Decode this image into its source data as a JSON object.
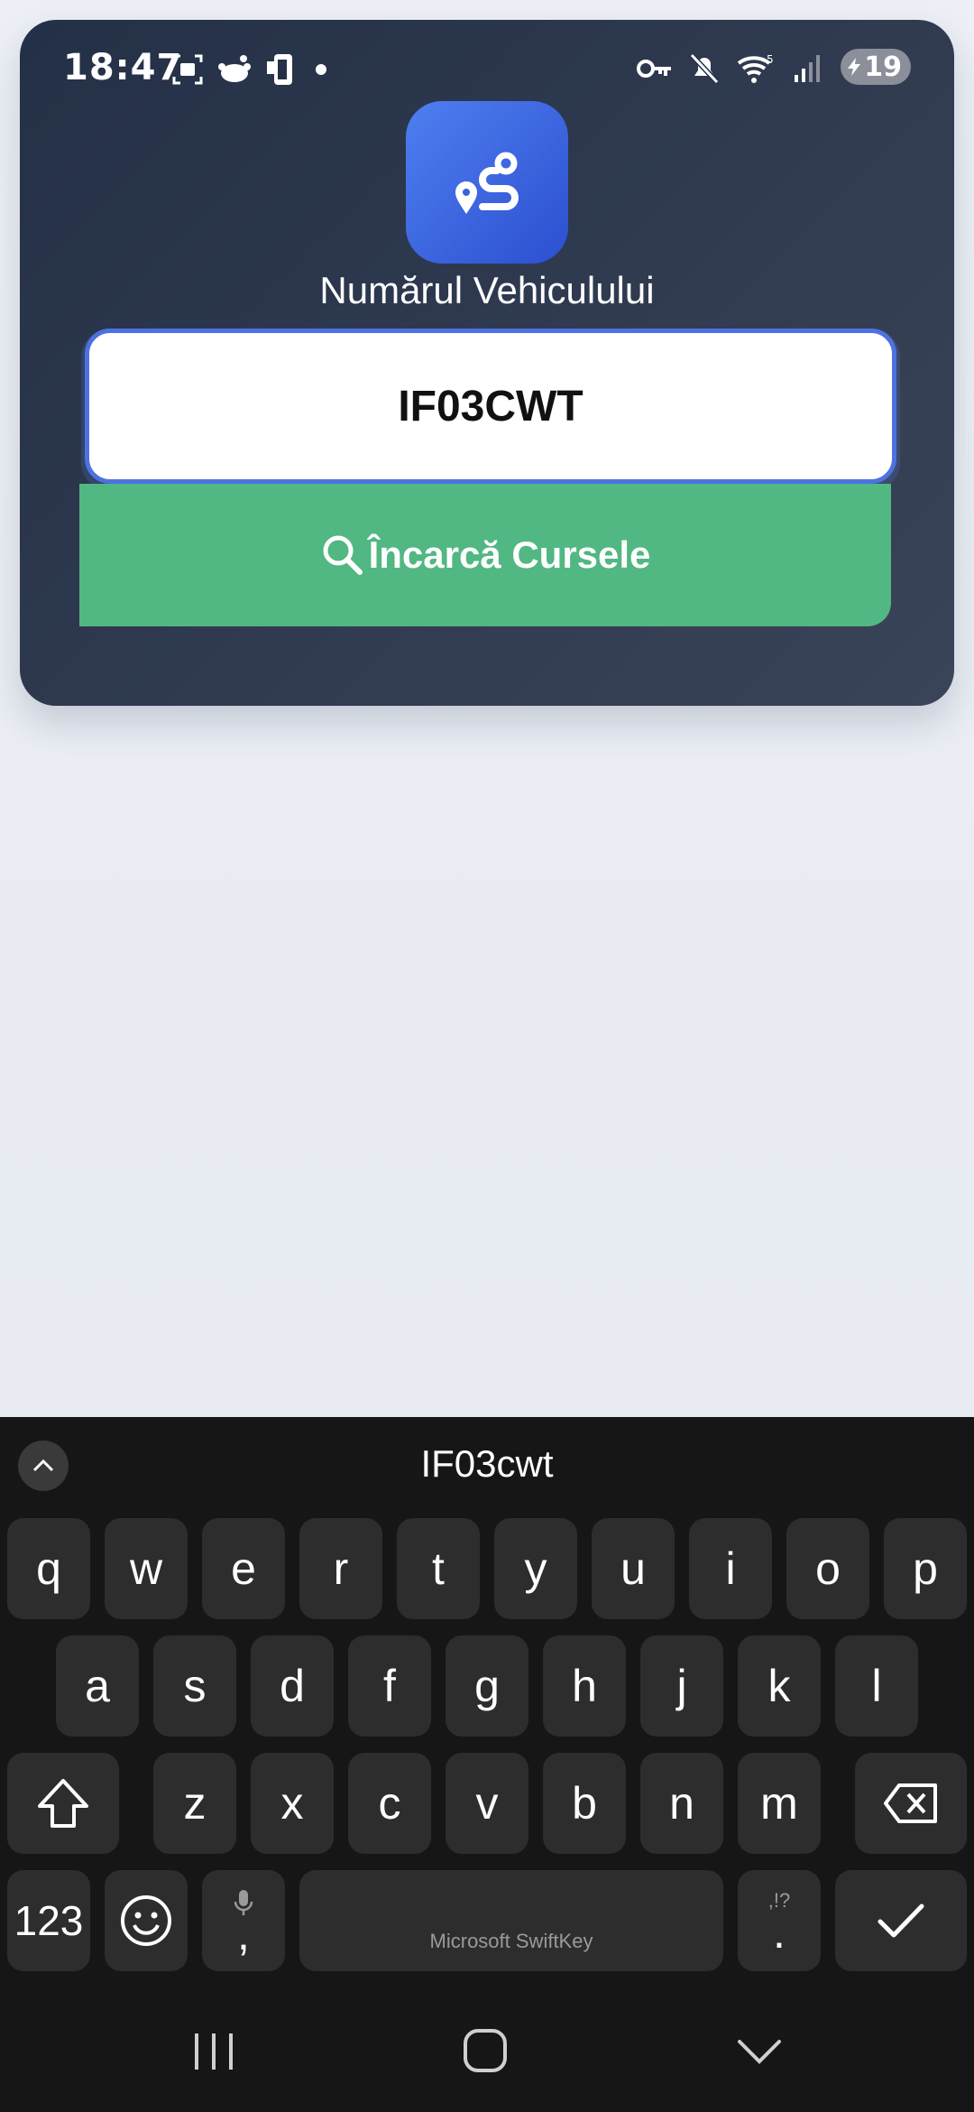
{
  "status_bar": {
    "time": "18:47",
    "battery": "19",
    "left_icons": [
      "screenshot-icon",
      "reddit-icon",
      "payment-icon",
      "dot-icon"
    ],
    "right_icons": [
      "vpn-key-icon",
      "mute-icon",
      "wifi-icon",
      "signal-icon"
    ]
  },
  "app": {
    "logo_icon": "route-icon",
    "field_label": "Numărul Vehiculului",
    "vehicle_input_value": "IF03CWT",
    "load_button_label": "Încarcă Cursele",
    "colors": {
      "accent": "#4d72e0",
      "button": "#51b783",
      "card": "#2b3549"
    }
  },
  "keyboard": {
    "suggestion": "IF03cwt",
    "row1": [
      "q",
      "w",
      "e",
      "r",
      "t",
      "y",
      "u",
      "i",
      "o",
      "p"
    ],
    "row2": [
      "a",
      "s",
      "d",
      "f",
      "g",
      "h",
      "j",
      "k",
      "l"
    ],
    "row3": [
      "z",
      "x",
      "c",
      "v",
      "b",
      "n",
      "m"
    ],
    "numbers_key": "123",
    "comma_key": ",",
    "space_label": "Microsoft SwiftKey",
    "period_key": ".",
    "punct_hint": ",!?"
  }
}
